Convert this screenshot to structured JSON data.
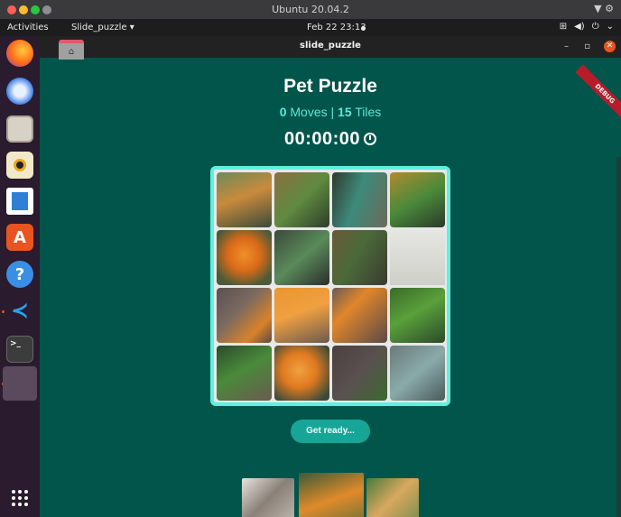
{
  "host": {
    "title": "Ubuntu 20.04.2"
  },
  "ubuntu_bar": {
    "activities": "Activities",
    "app_menu": "Slide_puzzle ▾",
    "clock": "Feb 22  23:13"
  },
  "dock": {
    "items": [
      "firefox-icon",
      "thunderbird-icon",
      "files-icon",
      "rhythmbox-icon",
      "writer-icon",
      "software-icon",
      "help-icon",
      "vscode-icon",
      "terminal-icon",
      "app-placeholder-icon",
      "show-apps-icon"
    ]
  },
  "window": {
    "title": "slide_puzzle",
    "debug_label": "DEBUG"
  },
  "game": {
    "title": "Pet Puzzle",
    "moves": "0",
    "moves_label": "Moves",
    "separator": "|",
    "tiles": "15",
    "tiles_label": "Tiles",
    "timer": "00:00:00",
    "button": "Get ready..."
  },
  "thumbnails": [
    "kittens",
    "goldfish",
    "puppies"
  ],
  "selected_thumbnail": "goldfish"
}
